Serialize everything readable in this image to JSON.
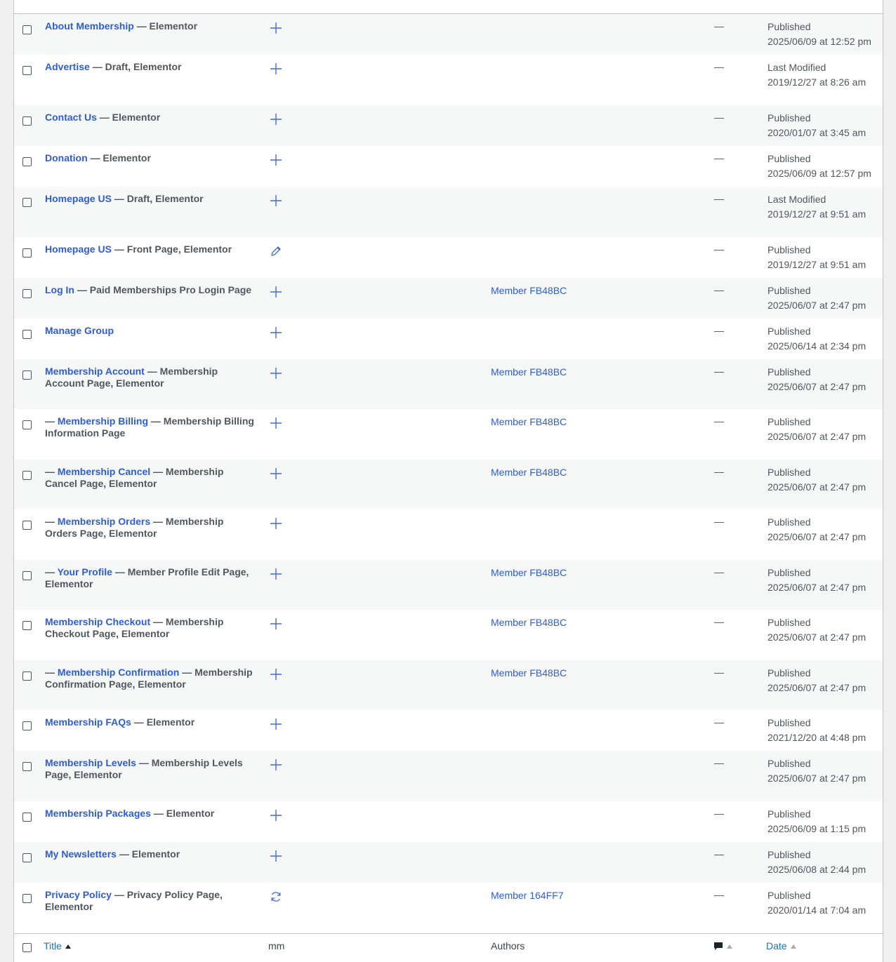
{
  "columns": {
    "title": "Title",
    "mm": "mm",
    "authors": "Authors",
    "date": "Date"
  },
  "rows": [
    {
      "prefix": "",
      "title": "About Membership",
      "suffix": " — Elementor",
      "icon": "plus-icon",
      "author": "",
      "comments": "—",
      "status": "Published",
      "date": "2025/06/09 at 12:52 pm"
    },
    {
      "prefix": "",
      "title": "Advertise",
      "suffix": " — Draft, Elementor",
      "icon": "plus-icon",
      "author": "",
      "comments": "—",
      "status": "Last Modified",
      "date": "2019/12/27 at 8:26 am"
    },
    {
      "prefix": "",
      "title": "Contact Us",
      "suffix": " — Elementor",
      "icon": "plus-icon",
      "author": "",
      "comments": "—",
      "status": "Published",
      "date": "2020/01/07 at 3:45 am"
    },
    {
      "prefix": "",
      "title": "Donation",
      "suffix": " — Elementor",
      "icon": "plus-icon",
      "author": "",
      "comments": "—",
      "status": "Published",
      "date": "2025/06/09 at 12:57 pm"
    },
    {
      "prefix": "",
      "title": "Homepage US",
      "suffix": " — Draft, Elementor",
      "icon": "plus-icon",
      "author": "",
      "comments": "—",
      "status": "Last Modified",
      "date": "2019/12/27 at 9:51 am"
    },
    {
      "prefix": "",
      "title": "Homepage US",
      "suffix": " — Front Page, Elementor",
      "icon": "pencil-icon",
      "author": "",
      "comments": "—",
      "status": "Published",
      "date": "2019/12/27 at 9:51 am"
    },
    {
      "prefix": "",
      "title": "Log In",
      "suffix": " — Paid Memberships Pro Login Page",
      "icon": "plus-icon",
      "author": "Member FB48BC",
      "comments": "—",
      "status": "Published",
      "date": "2025/06/07 at 2:47 pm"
    },
    {
      "prefix": "",
      "title": "Manage Group",
      "suffix": "",
      "icon": "plus-icon",
      "author": "",
      "comments": "—",
      "status": "Published",
      "date": "2025/06/14 at 2:34 pm"
    },
    {
      "prefix": "",
      "title": "Membership Account",
      "suffix": " — Membership Account Page, Elementor",
      "icon": "plus-icon",
      "author": "Member FB48BC",
      "comments": "—",
      "status": "Published",
      "date": "2025/06/07 at 2:47 pm"
    },
    {
      "prefix": "— ",
      "title": "Membership Billing",
      "suffix": " — Membership Billing Information Page",
      "icon": "plus-icon",
      "author": "Member FB48BC",
      "comments": "—",
      "status": "Published",
      "date": "2025/06/07 at 2:47 pm"
    },
    {
      "prefix": "— ",
      "title": "Membership Cancel",
      "suffix": " — Membership Cancel Page, Elementor",
      "icon": "plus-icon",
      "author": "Member FB48BC",
      "comments": "—",
      "status": "Published",
      "date": "2025/06/07 at 2:47 pm"
    },
    {
      "prefix": "— ",
      "title": "Membership Orders",
      "suffix": " — Membership Orders Page, Elementor",
      "icon": "plus-icon",
      "author": "",
      "comments": "—",
      "status": "Published",
      "date": "2025/06/07 at 2:47 pm"
    },
    {
      "prefix": "— ",
      "title": "Your Profile",
      "suffix": " — Member Profile Edit Page, Elementor",
      "icon": "plus-icon",
      "author": "Member FB48BC",
      "comments": "—",
      "status": "Published",
      "date": "2025/06/07 at 2:47 pm"
    },
    {
      "prefix": "",
      "title": "Membership Checkout",
      "suffix": " — Membership Checkout Page, Elementor",
      "icon": "plus-icon",
      "author": "Member FB48BC",
      "comments": "—",
      "status": "Published",
      "date": "2025/06/07 at 2:47 pm"
    },
    {
      "prefix": "— ",
      "title": "Membership Confirmation",
      "suffix": " — Membership Confirmation Page, Elementor",
      "icon": "plus-icon",
      "author": "Member FB48BC",
      "comments": "—",
      "status": "Published",
      "date": "2025/06/07 at 2:47 pm"
    },
    {
      "prefix": "",
      "title": "Membership FAQs",
      "suffix": " — Elementor",
      "icon": "plus-icon",
      "author": "",
      "comments": "—",
      "status": "Published",
      "date": "2021/12/20 at 4:48 pm"
    },
    {
      "prefix": "",
      "title": "Membership Levels",
      "suffix": " — Membership Levels Page, Elementor",
      "icon": "plus-icon",
      "author": "",
      "comments": "—",
      "status": "Published",
      "date": "2025/06/07 at 2:47 pm"
    },
    {
      "prefix": "",
      "title": "Membership Packages",
      "suffix": " — Elementor",
      "icon": "plus-icon",
      "author": "",
      "comments": "—",
      "status": "Published",
      "date": "2025/06/09 at 1:15 pm"
    },
    {
      "prefix": "",
      "title": "My Newsletters",
      "suffix": " — Elementor",
      "icon": "plus-icon",
      "author": "",
      "comments": "—",
      "status": "Published",
      "date": "2025/06/08 at 2:44 pm"
    },
    {
      "prefix": "",
      "title": "Privacy Policy",
      "suffix": " — Privacy Policy Page, Elementor",
      "icon": "refresh-icon",
      "author": "Member 164FF7",
      "comments": "—",
      "status": "Published",
      "date": "2020/01/14 at 7:04 am"
    }
  ]
}
